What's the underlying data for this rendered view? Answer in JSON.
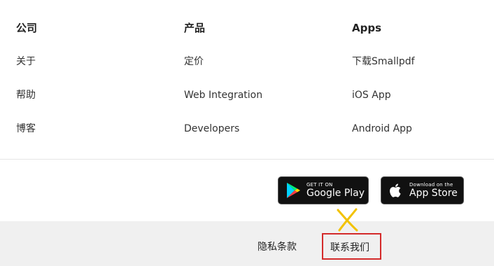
{
  "columns": [
    {
      "heading": "公司",
      "links": [
        "关于",
        "帮助",
        "博客"
      ]
    },
    {
      "heading": "产品",
      "links": [
        "定价",
        "Web Integration",
        "Developers"
      ]
    },
    {
      "heading": "Apps",
      "links": [
        "下载Smallpdf",
        "iOS App",
        "Android App"
      ]
    }
  ],
  "store_badges": {
    "google": {
      "small": "GET IT ON",
      "large": "Google Play",
      "icon": "google-play-icon"
    },
    "apple": {
      "small": "Download on the",
      "large": "App Store",
      "icon": "apple-icon"
    }
  },
  "bottom_links": {
    "privacy": "隐私条款",
    "contact": "联系我们"
  },
  "annotation": {
    "highlight_color": "#d42a2a",
    "x_mark_color": "#f2c200"
  },
  "colors": {
    "badge_bg": "#111111",
    "bottom_bar_bg": "#f0f0f0"
  }
}
